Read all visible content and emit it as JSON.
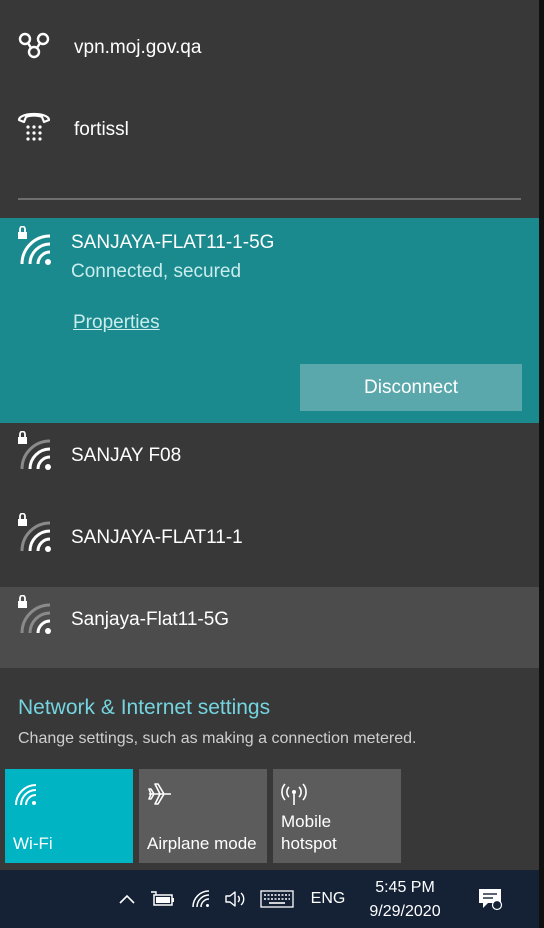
{
  "vpn": [
    {
      "label": "vpn.moj.gov.qa",
      "icon": "vpn-link-icon"
    },
    {
      "label": "fortissl",
      "icon": "dialup-phone-icon"
    }
  ],
  "connected_network": {
    "name": "SANJAYA-FLAT11-1-5G",
    "status": "Connected, secured",
    "properties_label": "Properties",
    "disconnect_label": "Disconnect",
    "icon": "secured-wifi-icon"
  },
  "networks": [
    {
      "name": "SANJAY F08",
      "icon": "secured-wifi-icon"
    },
    {
      "name": "SANJAYA-FLAT11-1",
      "icon": "secured-wifi-icon"
    },
    {
      "name": "Sanjaya-Flat11-5G",
      "icon": "secured-wifi-icon"
    }
  ],
  "settings": {
    "link": "Network & Internet settings",
    "subtitle": "Change settings, such as making a connection metered."
  },
  "quick_actions": [
    {
      "label": "Wi-Fi",
      "active": true,
      "icon": "wifi-icon"
    },
    {
      "label": "Airplane mode",
      "active": false,
      "icon": "airplane-icon"
    },
    {
      "label": "Mobile hotspot",
      "active": false,
      "icon": "hotspot-icon"
    }
  ],
  "taskbar": {
    "language": "ENG",
    "time": "5:45 PM",
    "date": "9/29/2020"
  },
  "colors": {
    "accent": "#1b8a8e",
    "tile_active": "#00b4c4",
    "link": "#74d4df",
    "panel": "#383838",
    "taskbar": "#152236"
  }
}
